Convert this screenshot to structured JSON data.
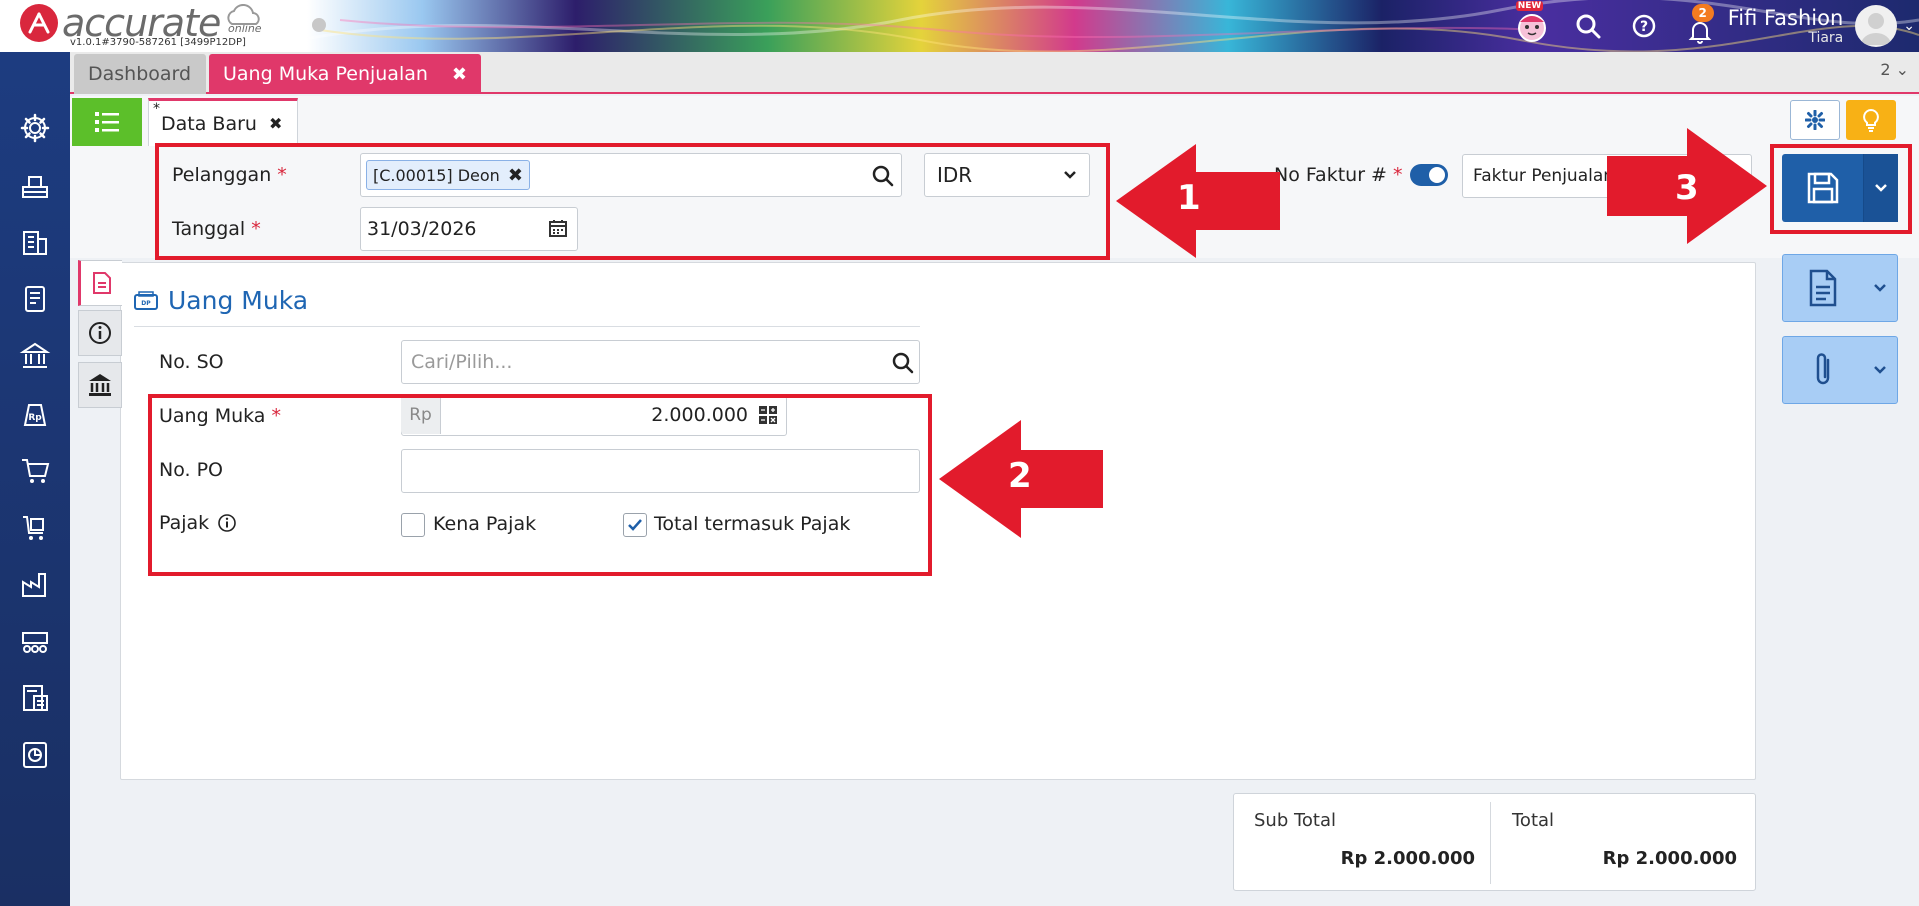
{
  "app": {
    "version": "v1.0.1#3790-587261 [3499P12DP]",
    "logo_text": "accurate",
    "logo_sub": "online",
    "new_badge": "NEW",
    "notification_count": "2",
    "user_name": "Fifi Fashion",
    "user_sub": "Tiara"
  },
  "tabs": {
    "dashboard": "Dashboard",
    "active": "Uang Muka Penjualan",
    "active_close": "✖",
    "count": "2 ⌄"
  },
  "doc_tab": {
    "star": "*",
    "label": "Data Baru",
    "close": "✖"
  },
  "header": {
    "pelanggan_label": "Pelanggan",
    "required_mark": "*",
    "customer_chip": "[C.00015] Deon",
    "chip_close": "✖",
    "currency": "IDR",
    "tanggal_label": "Tanggal",
    "tanggal_value": "31/03/2026",
    "no_faktur_label": "No Faktur #",
    "faktur_value": "Faktur Penjualan"
  },
  "section": {
    "title": "Uang Muka",
    "no_so_label": "No. SO",
    "no_so_placeholder": "Cari/Pilih...",
    "uang_muka_label": "Uang Muka",
    "rp_prefix": "Rp",
    "uang_muka_value": "2.000.000",
    "no_po_label": "No. PO",
    "no_po_value": "",
    "pajak_label": "Pajak",
    "kena_pajak_label": "Kena Pajak",
    "kena_pajak_checked": false,
    "total_termasuk_label": "Total termasuk Pajak",
    "total_termasuk_checked": true
  },
  "totals": {
    "sub_total_label": "Sub Total",
    "sub_total_value": "Rp 2.000.000",
    "total_label": "Total",
    "total_value": "Rp 2.000.000"
  },
  "annotations": {
    "one": "1",
    "two": "2",
    "three": "3"
  },
  "colors": {
    "accent_pink": "#e0386a",
    "primary_blue": "#1f5fa8",
    "sidebar_navy": "#1d3c80",
    "list_green": "#5cbf2a",
    "bulb_orange": "#f8b115",
    "annotation_red": "#e21b2c"
  },
  "icons": {
    "sidebar": [
      "gear-icon",
      "inventory-icon",
      "building-icon",
      "ledger-icon",
      "bank-icon",
      "receivable-icon",
      "cart-icon",
      "purchase-icon",
      "factory-icon",
      "conveyor-icon",
      "tax-icon",
      "report-icon"
    ]
  }
}
